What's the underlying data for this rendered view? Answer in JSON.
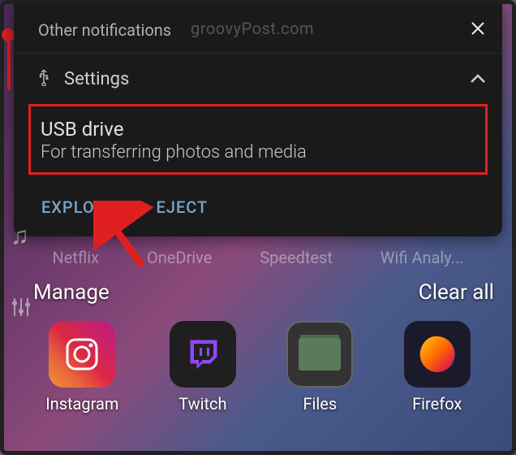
{
  "watermark": "groovyPost.com",
  "panel": {
    "title": "Other notifications",
    "settings_label": "Settings",
    "usb_title": "USB drive",
    "usb_subtitle": "For transferring photos and media",
    "explore_label": "EXPLORE",
    "eject_label": "EJECT"
  },
  "bg_apps_top": {
    "netflix": "Netflix",
    "onedrive": "OneDrive",
    "speedtest": "Speedtest",
    "wifi": "Wifi Analy..."
  },
  "manage_label": "Manage",
  "clearall_label": "Clear all",
  "apps": {
    "instagram": "Instagram",
    "twitch": "Twitch",
    "files": "Files",
    "firefox": "Firefox"
  }
}
